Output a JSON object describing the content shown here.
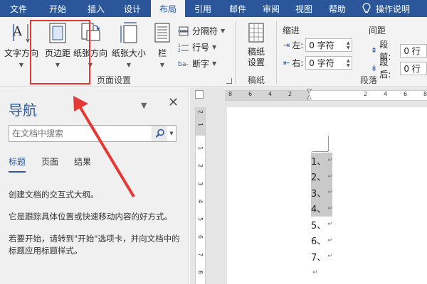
{
  "ribbon_tabs": [
    "文件",
    "开始",
    "插入",
    "设计",
    "布局",
    "引用",
    "邮件",
    "审阅",
    "视图",
    "帮助"
  ],
  "tell_me": "操作说明",
  "page_setup": {
    "text_direction": "文字方向",
    "margins": "页边距",
    "orientation": "纸张方向",
    "size": "纸张大小",
    "columns": "栏",
    "breaks": "分隔符",
    "line_numbers": "行号",
    "hyphenation": "断字",
    "group_label": "页面设置"
  },
  "manuscript": {
    "button": "稿纸设置",
    "group_label": "稿纸"
  },
  "paragraph": {
    "indent_title": "缩进",
    "spacing_title": "间距",
    "left_label": "左:",
    "right_label": "右:",
    "left_value": "0 字符",
    "right_value": "0 字符",
    "before_label": "段前:",
    "after_label": "段后:",
    "before_value": "0 行",
    "after_value": "0 行",
    "group_label": "段落"
  },
  "nav": {
    "title": "导航",
    "search_placeholder": "在文档中搜索",
    "tabs": [
      "标题",
      "页面",
      "结果"
    ],
    "info1": "创建文档的交互式大纲。",
    "info2": "它是跟踪具体位置或快速移动内容的好方式。",
    "info3": "若要开始，请转到\"开始\"选项卡，并向文档中的标题应用标题样式。"
  },
  "ruler": {
    "h_numbers": [
      "8",
      "6",
      "4",
      "2",
      "2",
      "4",
      "6",
      "8",
      "10"
    ],
    "v_numbers": [
      "2",
      "1",
      "1",
      "2",
      "3",
      "4",
      "5",
      "6",
      "7",
      "8"
    ]
  },
  "document": {
    "lines": [
      "1、",
      "2、",
      "3、",
      "4、",
      "5、",
      "6、",
      "7、",
      "",
      ""
    ],
    "paragraph_mark": "↵"
  },
  "colors": {
    "accent": "#2b579a",
    "annotation": "#e53935",
    "selection": "#c9c9c9"
  }
}
